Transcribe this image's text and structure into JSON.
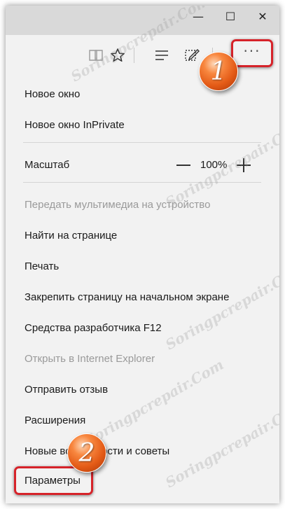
{
  "window_controls": {
    "minimize": "—",
    "maximize": "☐",
    "close": "✕"
  },
  "toolbar": {
    "icons": [
      "reading-view-icon",
      "favorite-star-icon",
      "hub-icon",
      "web-note-icon",
      "more-actions-icon"
    ],
    "more_label": "···"
  },
  "menu": {
    "new_window": "Новое окно",
    "new_inprivate": "Новое окно InPrivate",
    "zoom_label": "Масштаб",
    "zoom_value": "100%",
    "cast": "Передать мультимедиа на устройство",
    "find": "Найти на странице",
    "print": "Печать",
    "pin": "Закрепить страницу на начальном экране",
    "devtools": "Средства разработчика F12",
    "open_ie": "Открыть в Internet Explorer",
    "feedback": "Отправить отзыв",
    "extensions": "Расширения",
    "whats_new": "Новые возможности и советы",
    "settings": "Параметры"
  },
  "annotations": {
    "step1": "1",
    "step2": "2"
  },
  "watermark": "Soringpcrepair.Com",
  "colors": {
    "highlight": "#d6232a",
    "badge": "#e35a16",
    "menu_bg": "#f2f2f2",
    "titlebar_bg": "#d9d9d9"
  }
}
